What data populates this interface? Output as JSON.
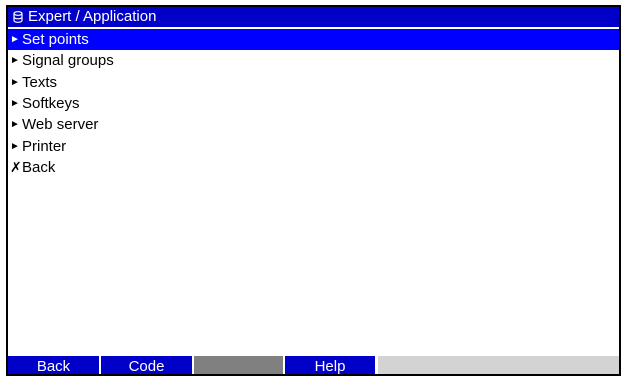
{
  "header": {
    "icon": "database-icon",
    "title": "Expert / Application"
  },
  "menu": {
    "items": [
      {
        "label": "Set points",
        "marker": "►",
        "selected": true
      },
      {
        "label": "Signal groups",
        "marker": "►",
        "selected": false
      },
      {
        "label": "Texts",
        "marker": "►",
        "selected": false
      },
      {
        "label": "Softkeys",
        "marker": "►",
        "selected": false
      },
      {
        "label": "Web server",
        "marker": "►",
        "selected": false
      },
      {
        "label": "Printer",
        "marker": "►",
        "selected": false
      },
      {
        "label": "Back",
        "marker": "✗",
        "selected": false
      }
    ]
  },
  "softkeys": [
    {
      "label": "Back"
    },
    {
      "label": "Code"
    },
    {
      "label": ""
    },
    {
      "label": "Help"
    },
    {
      "label": ""
    }
  ],
  "colors": {
    "title_bg": "#0000c8",
    "selection_bg": "#0000ff",
    "softkey_bg": "#0000c8",
    "softkey_disabled": "#808080",
    "softkey_empty": "#d3d3d3"
  }
}
